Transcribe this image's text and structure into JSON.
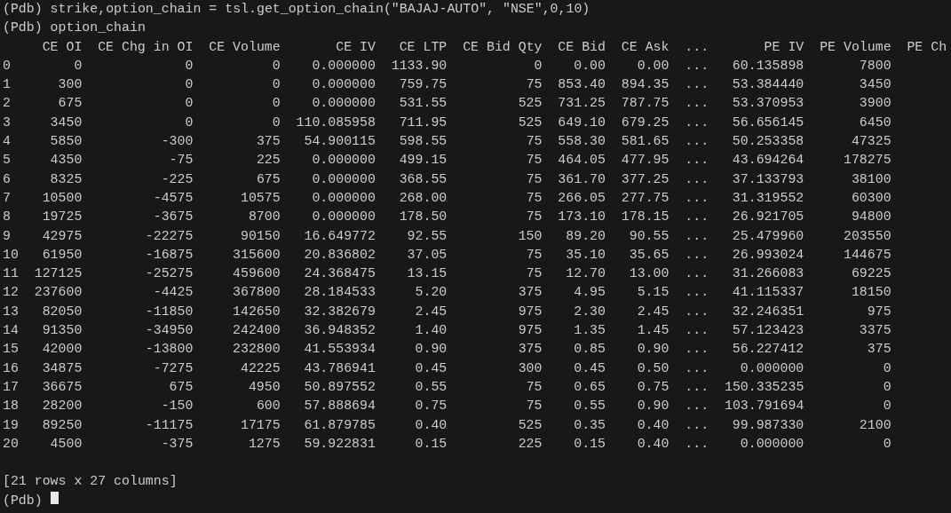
{
  "terminal": {
    "lines": [
      {
        "kind": "command",
        "text": "(Pdb) strike,option_chain = tsl.get_option_chain(\"BAJAJ-AUTO\", \"NSE\",0,10)"
      },
      {
        "kind": "command",
        "text": "(Pdb) option_chain"
      }
    ],
    "table": {
      "columns": [
        "CE OI",
        "CE Chg in OI",
        "CE Volume",
        "CE IV",
        "CE LTP",
        "CE Bid Qty",
        "CE Bid",
        "CE Ask",
        "...",
        "PE IV",
        "PE Volume",
        "PE Ch"
      ],
      "rows": [
        {
          "index": "0",
          "cells": [
            "0",
            "0",
            "0",
            "0.000000",
            "1133.90",
            "0",
            "0.00",
            "0.00",
            "...",
            "60.135898",
            "7800"
          ]
        },
        {
          "index": "1",
          "cells": [
            "300",
            "0",
            "0",
            "0.000000",
            "759.75",
            "75",
            "853.40",
            "894.35",
            "...",
            "53.384440",
            "3450"
          ]
        },
        {
          "index": "2",
          "cells": [
            "675",
            "0",
            "0",
            "0.000000",
            "531.55",
            "525",
            "731.25",
            "787.75",
            "...",
            "53.370953",
            "3900"
          ]
        },
        {
          "index": "3",
          "cells": [
            "3450",
            "0",
            "0",
            "110.085958",
            "711.95",
            "525",
            "649.10",
            "679.25",
            "...",
            "56.656145",
            "6450"
          ]
        },
        {
          "index": "4",
          "cells": [
            "5850",
            "-300",
            "375",
            "54.900115",
            "598.55",
            "75",
            "558.30",
            "581.65",
            "...",
            "50.253358",
            "47325"
          ]
        },
        {
          "index": "5",
          "cells": [
            "4350",
            "-75",
            "225",
            "0.000000",
            "499.15",
            "75",
            "464.05",
            "477.95",
            "...",
            "43.694264",
            "178275"
          ]
        },
        {
          "index": "6",
          "cells": [
            "8325",
            "-225",
            "675",
            "0.000000",
            "368.55",
            "75",
            "361.70",
            "377.25",
            "...",
            "37.133793",
            "38100"
          ]
        },
        {
          "index": "7",
          "cells": [
            "10500",
            "-4575",
            "10575",
            "0.000000",
            "268.00",
            "75",
            "266.05",
            "277.75",
            "...",
            "31.319552",
            "60300"
          ]
        },
        {
          "index": "8",
          "cells": [
            "19725",
            "-3675",
            "8700",
            "0.000000",
            "178.50",
            "75",
            "173.10",
            "178.15",
            "...",
            "26.921705",
            "94800"
          ]
        },
        {
          "index": "9",
          "cells": [
            "42975",
            "-22275",
            "90150",
            "16.649772",
            "92.55",
            "150",
            "89.20",
            "90.55",
            "...",
            "25.479960",
            "203550"
          ]
        },
        {
          "index": "10",
          "cells": [
            "61950",
            "-16875",
            "315600",
            "20.836802",
            "37.05",
            "75",
            "35.10",
            "35.65",
            "...",
            "26.993024",
            "144675"
          ]
        },
        {
          "index": "11",
          "cells": [
            "127125",
            "-25275",
            "459600",
            "24.368475",
            "13.15",
            "75",
            "12.70",
            "13.00",
            "...",
            "31.266083",
            "69225"
          ]
        },
        {
          "index": "12",
          "cells": [
            "237600",
            "-4425",
            "367800",
            "28.184533",
            "5.20",
            "375",
            "4.95",
            "5.15",
            "...",
            "41.115337",
            "18150"
          ]
        },
        {
          "index": "13",
          "cells": [
            "82050",
            "-11850",
            "142650",
            "32.382679",
            "2.45",
            "975",
            "2.30",
            "2.45",
            "...",
            "32.246351",
            "975"
          ]
        },
        {
          "index": "14",
          "cells": [
            "91350",
            "-34950",
            "242400",
            "36.948352",
            "1.40",
            "975",
            "1.35",
            "1.45",
            "...",
            "57.123423",
            "3375"
          ]
        },
        {
          "index": "15",
          "cells": [
            "42000",
            "-13800",
            "232800",
            "41.553934",
            "0.90",
            "375",
            "0.85",
            "0.90",
            "...",
            "56.227412",
            "375"
          ]
        },
        {
          "index": "16",
          "cells": [
            "34875",
            "-7275",
            "42225",
            "43.786941",
            "0.45",
            "300",
            "0.45",
            "0.50",
            "...",
            "0.000000",
            "0"
          ]
        },
        {
          "index": "17",
          "cells": [
            "36675",
            "675",
            "4950",
            "50.897552",
            "0.55",
            "75",
            "0.65",
            "0.75",
            "...",
            "150.335235",
            "0"
          ]
        },
        {
          "index": "18",
          "cells": [
            "28200",
            "-150",
            "600",
            "57.888694",
            "0.75",
            "75",
            "0.55",
            "0.90",
            "...",
            "103.791694",
            "0"
          ]
        },
        {
          "index": "19",
          "cells": [
            "89250",
            "-11175",
            "17175",
            "61.879785",
            "0.40",
            "525",
            "0.35",
            "0.40",
            "...",
            "99.987330",
            "2100"
          ]
        },
        {
          "index": "20",
          "cells": [
            "4500",
            "-375",
            "1275",
            "59.922831",
            "0.15",
            "225",
            "0.15",
            "0.40",
            "...",
            "0.000000",
            "0"
          ]
        }
      ]
    },
    "summary": "[21 rows x 27 columns]",
    "prompt": "(Pdb)"
  }
}
